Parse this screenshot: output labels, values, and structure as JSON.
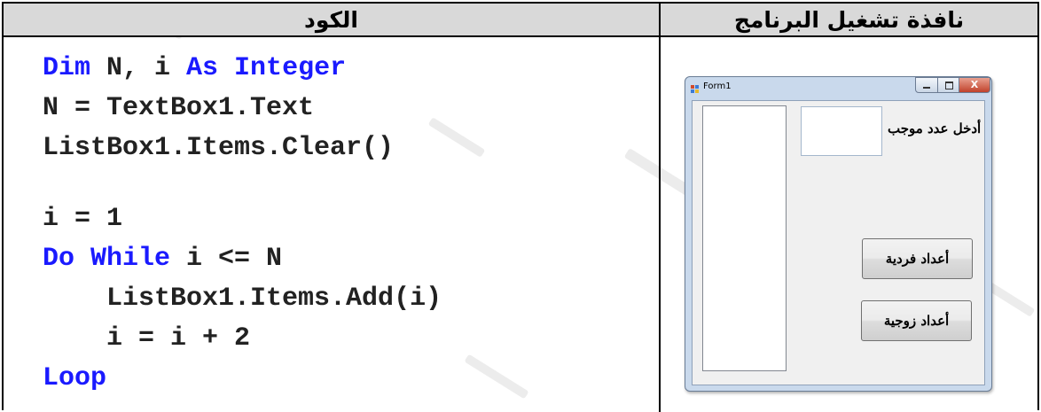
{
  "headers": {
    "code": "الكود",
    "program_window": "نافذة تشغيل البرنامج"
  },
  "code_lines": [
    {
      "kw": "Dim",
      "rest": " N, i ",
      "kw2": "As Integer",
      "rest2": ""
    },
    {
      "kw": "",
      "rest": "N = TextBox1.Text",
      "kw2": "",
      "rest2": ""
    },
    {
      "kw": "",
      "rest": "ListBox1.Items.Clear()",
      "kw2": "",
      "rest2": ""
    },
    {
      "kw": "",
      "rest": "i = 1",
      "kw2": "",
      "rest2": ""
    },
    {
      "kw": "Do While",
      "rest": " i <= N",
      "kw2": "",
      "rest2": ""
    },
    {
      "kw": "",
      "rest": "    ListBox1.Items.Add(i)",
      "kw2": "",
      "rest2": ""
    },
    {
      "kw": "",
      "rest": "    i = i + 2",
      "kw2": "",
      "rest2": ""
    },
    {
      "kw": "Loop",
      "rest": "",
      "kw2": "",
      "rest2": ""
    }
  ],
  "form": {
    "title": "Form1",
    "close_glyph": "X",
    "prompt_label": "أدخل عدد موجب",
    "textbox_value": "",
    "listbox_items": [],
    "odd_button": "أعداد فردية",
    "even_button": "أعداد زوجية"
  },
  "colors": {
    "keyword": "#1a1aff",
    "header_bg": "#d9d9d9"
  }
}
